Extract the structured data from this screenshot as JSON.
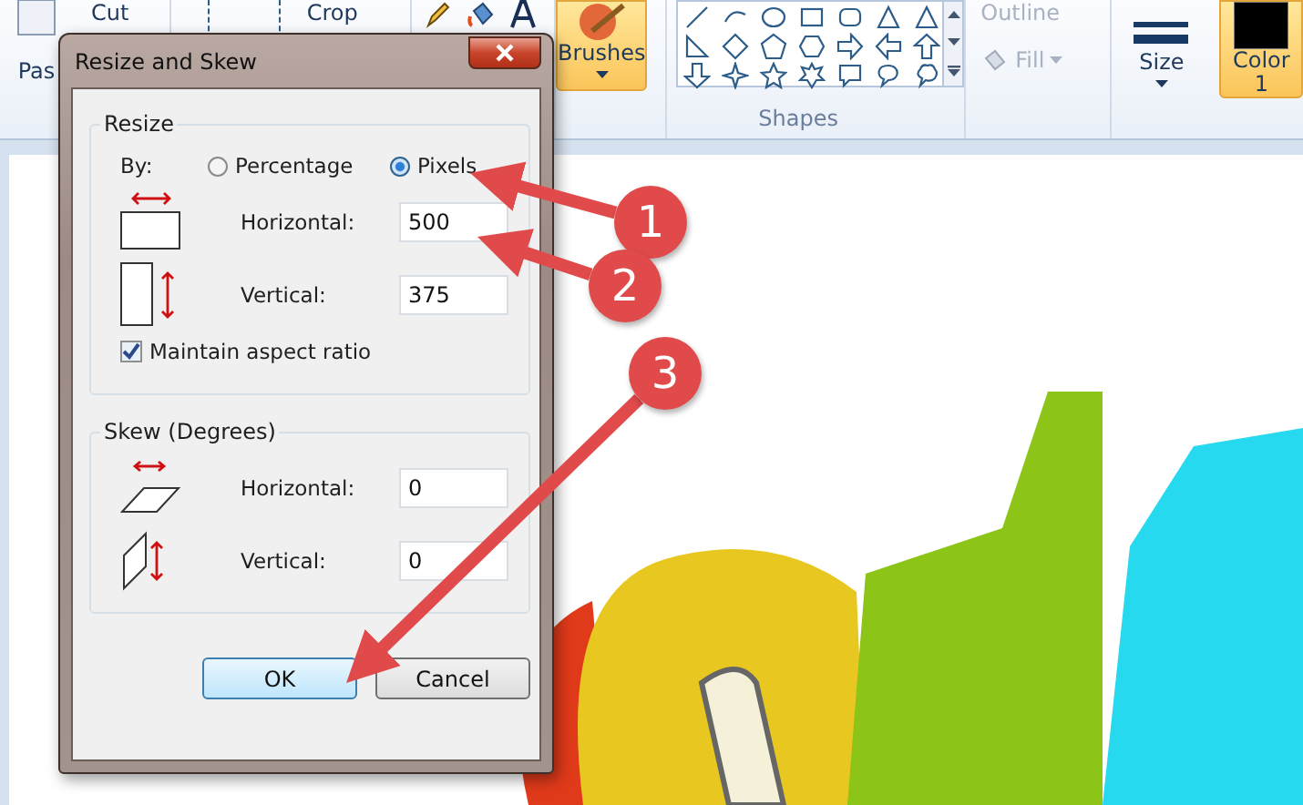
{
  "ribbon": {
    "clipboard": {
      "paste": "Pas",
      "cut": "Cut"
    },
    "image": {
      "crop": "Crop"
    },
    "brushes": {
      "label": "Brushes",
      "selected": true
    },
    "shapes": {
      "label": "Shapes"
    },
    "outline": "Outline",
    "fill": "Fill",
    "size": "Size",
    "color1": {
      "label": "Color",
      "number": "1",
      "selected": true
    }
  },
  "dialog": {
    "title": "Resize and Skew",
    "resize": {
      "title": "Resize",
      "by_label": "By:",
      "options": [
        {
          "label": "Percentage",
          "selected": false
        },
        {
          "label": "Pixels",
          "selected": true
        }
      ],
      "fields": [
        {
          "kind": "horizontal",
          "label": "Horizontal:",
          "value": "500"
        },
        {
          "kind": "vertical",
          "label": "Vertical:",
          "value": "375"
        }
      ],
      "maintain_aspect": {
        "label": "Maintain aspect ratio",
        "checked": true
      }
    },
    "skew": {
      "title": "Skew (Degrees)",
      "fields": [
        {
          "kind": "horizontal",
          "label": "Horizontal:",
          "value": "0"
        },
        {
          "kind": "vertical",
          "label": "Vertical:",
          "value": "0"
        }
      ]
    },
    "buttons": [
      {
        "label": "OK",
        "default": true
      },
      {
        "label": "Cancel",
        "default": false
      }
    ]
  },
  "annotations": [
    {
      "number": "1"
    },
    {
      "number": "2"
    },
    {
      "number": "3"
    }
  ]
}
